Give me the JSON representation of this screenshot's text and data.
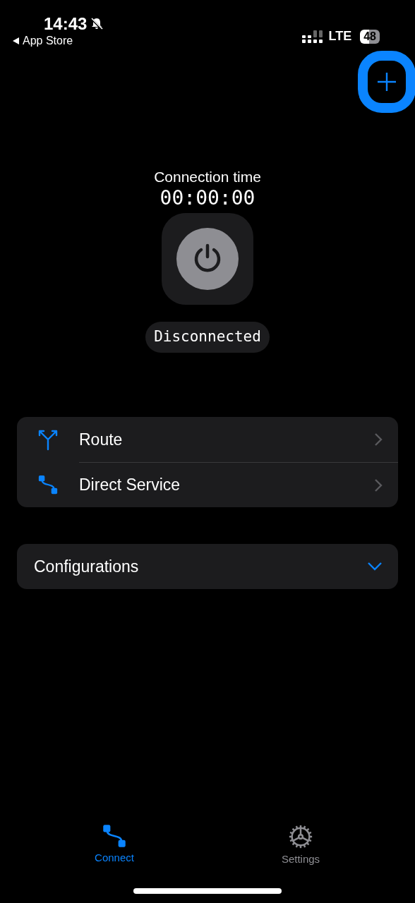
{
  "status_bar": {
    "time": "14:43",
    "back_label": "App Store",
    "network": "LTE",
    "battery": "48"
  },
  "header": {
    "add_button": {
      "highlighted": true
    }
  },
  "connection": {
    "title": "Connection time",
    "timer": "00:00:00",
    "status": "Disconnected",
    "connected": false
  },
  "menu": [
    {
      "kind": "route",
      "label": "Route"
    },
    {
      "kind": "direct",
      "label": "Direct Service"
    }
  ],
  "configurations": {
    "label": "Configurations",
    "expanded": false
  },
  "tabs": [
    {
      "kind": "connect",
      "label": "Connect",
      "selected": true
    },
    {
      "kind": "settings",
      "label": "Settings",
      "selected": false
    }
  ]
}
